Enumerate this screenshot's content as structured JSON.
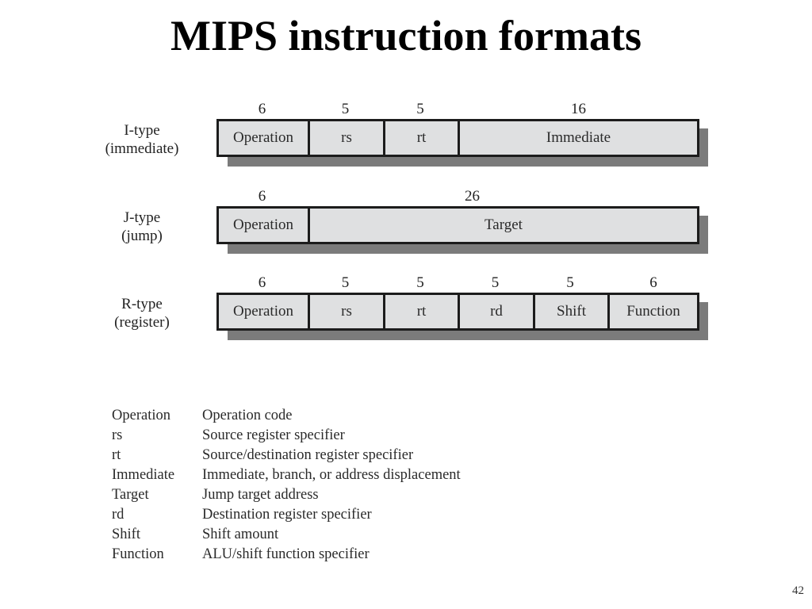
{
  "slide": {
    "title": "MIPS instruction formats",
    "page_number": "42"
  },
  "formats": [
    {
      "name": "I-type",
      "subtitle": "(immediate)",
      "fields": [
        {
          "label": "Operation",
          "bits": "6"
        },
        {
          "label": "rs",
          "bits": "5"
        },
        {
          "label": "rt",
          "bits": "5"
        },
        {
          "label": "Immediate",
          "bits": "16"
        }
      ]
    },
    {
      "name": "J-type",
      "subtitle": "(jump)",
      "fields": [
        {
          "label": "Operation",
          "bits": "6"
        },
        {
          "label": "Target",
          "bits": "26"
        }
      ]
    },
    {
      "name": "R-type",
      "subtitle": "(register)",
      "fields": [
        {
          "label": "Operation",
          "bits": "6"
        },
        {
          "label": "rs",
          "bits": "5"
        },
        {
          "label": "rt",
          "bits": "5"
        },
        {
          "label": "rd",
          "bits": "5"
        },
        {
          "label": "Shift",
          "bits": "5"
        },
        {
          "label": "Function",
          "bits": "6"
        }
      ]
    }
  ],
  "legend": [
    {
      "term": "Operation",
      "description": "Operation code"
    },
    {
      "term": "rs",
      "description": "Source register specifier"
    },
    {
      "term": "rt",
      "description": "Source/destination register specifier"
    },
    {
      "term": "Immediate",
      "description": "Immediate, branch, or address displacement"
    },
    {
      "term": "Target",
      "description": "Jump target address"
    },
    {
      "term": "rd",
      "description": "Destination register specifier"
    },
    {
      "term": "Shift",
      "description": "Shift amount"
    },
    {
      "term": "Function",
      "description": "ALU/shift function specifier"
    }
  ]
}
